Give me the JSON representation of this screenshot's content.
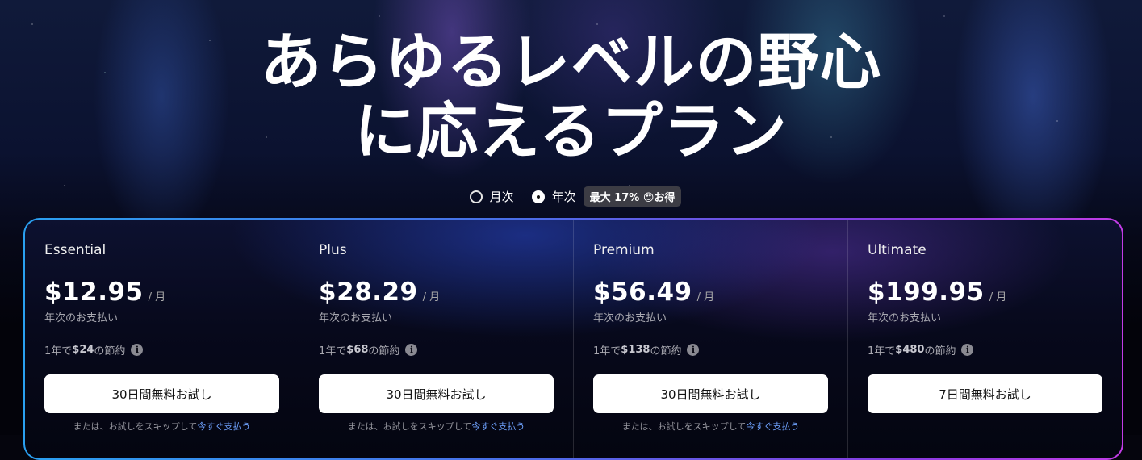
{
  "hero": {
    "title_line1": "あらゆるレベルの野心",
    "title_line2": "に応えるプラン"
  },
  "billing_toggle": {
    "monthly_label": "月次",
    "annual_label": "年次",
    "selected": "annual",
    "badge_prefix": "最大 17% ",
    "badge_emoji": "😍",
    "badge_suffix": "お得"
  },
  "colors": {
    "border_gradient": [
      "#2aa0f0",
      "#4a6de8",
      "#8a3be0",
      "#c23ce6"
    ],
    "link": "#6fa2ff",
    "cta_bg": "#ffffff"
  },
  "plans": [
    {
      "name": "Essential",
      "price": "$12.95",
      "per": "/ 月",
      "billing": "年次のお支払い",
      "savings_prefix": "1年で",
      "savings_amount": "$24",
      "savings_suffix": " の節約",
      "cta": "30日間無料お試し",
      "skip_text": "または、お試しをスキップして",
      "skip_link": "今すぐ支払う"
    },
    {
      "name": "Plus",
      "price": "$28.29",
      "per": "/ 月",
      "billing": "年次のお支払い",
      "savings_prefix": "1年で",
      "savings_amount": "$68",
      "savings_suffix": " の節約",
      "cta": "30日間無料お試し",
      "skip_text": "または、お試しをスキップして",
      "skip_link": "今すぐ支払う"
    },
    {
      "name": "Premium",
      "price": "$56.49",
      "per": "/ 月",
      "billing": "年次のお支払い",
      "savings_prefix": "1年で",
      "savings_amount": "$138",
      "savings_suffix": " の節約",
      "cta": "30日間無料お試し",
      "skip_text": "または、お試しをスキップして",
      "skip_link": "今すぐ支払う"
    },
    {
      "name": "Ultimate",
      "price": "$199.95",
      "per": "/ 月",
      "billing": "年次のお支払い",
      "savings_prefix": "1年で",
      "savings_amount": "$480",
      "savings_suffix": " の節約",
      "cta": "7日間無料お試し"
    }
  ]
}
